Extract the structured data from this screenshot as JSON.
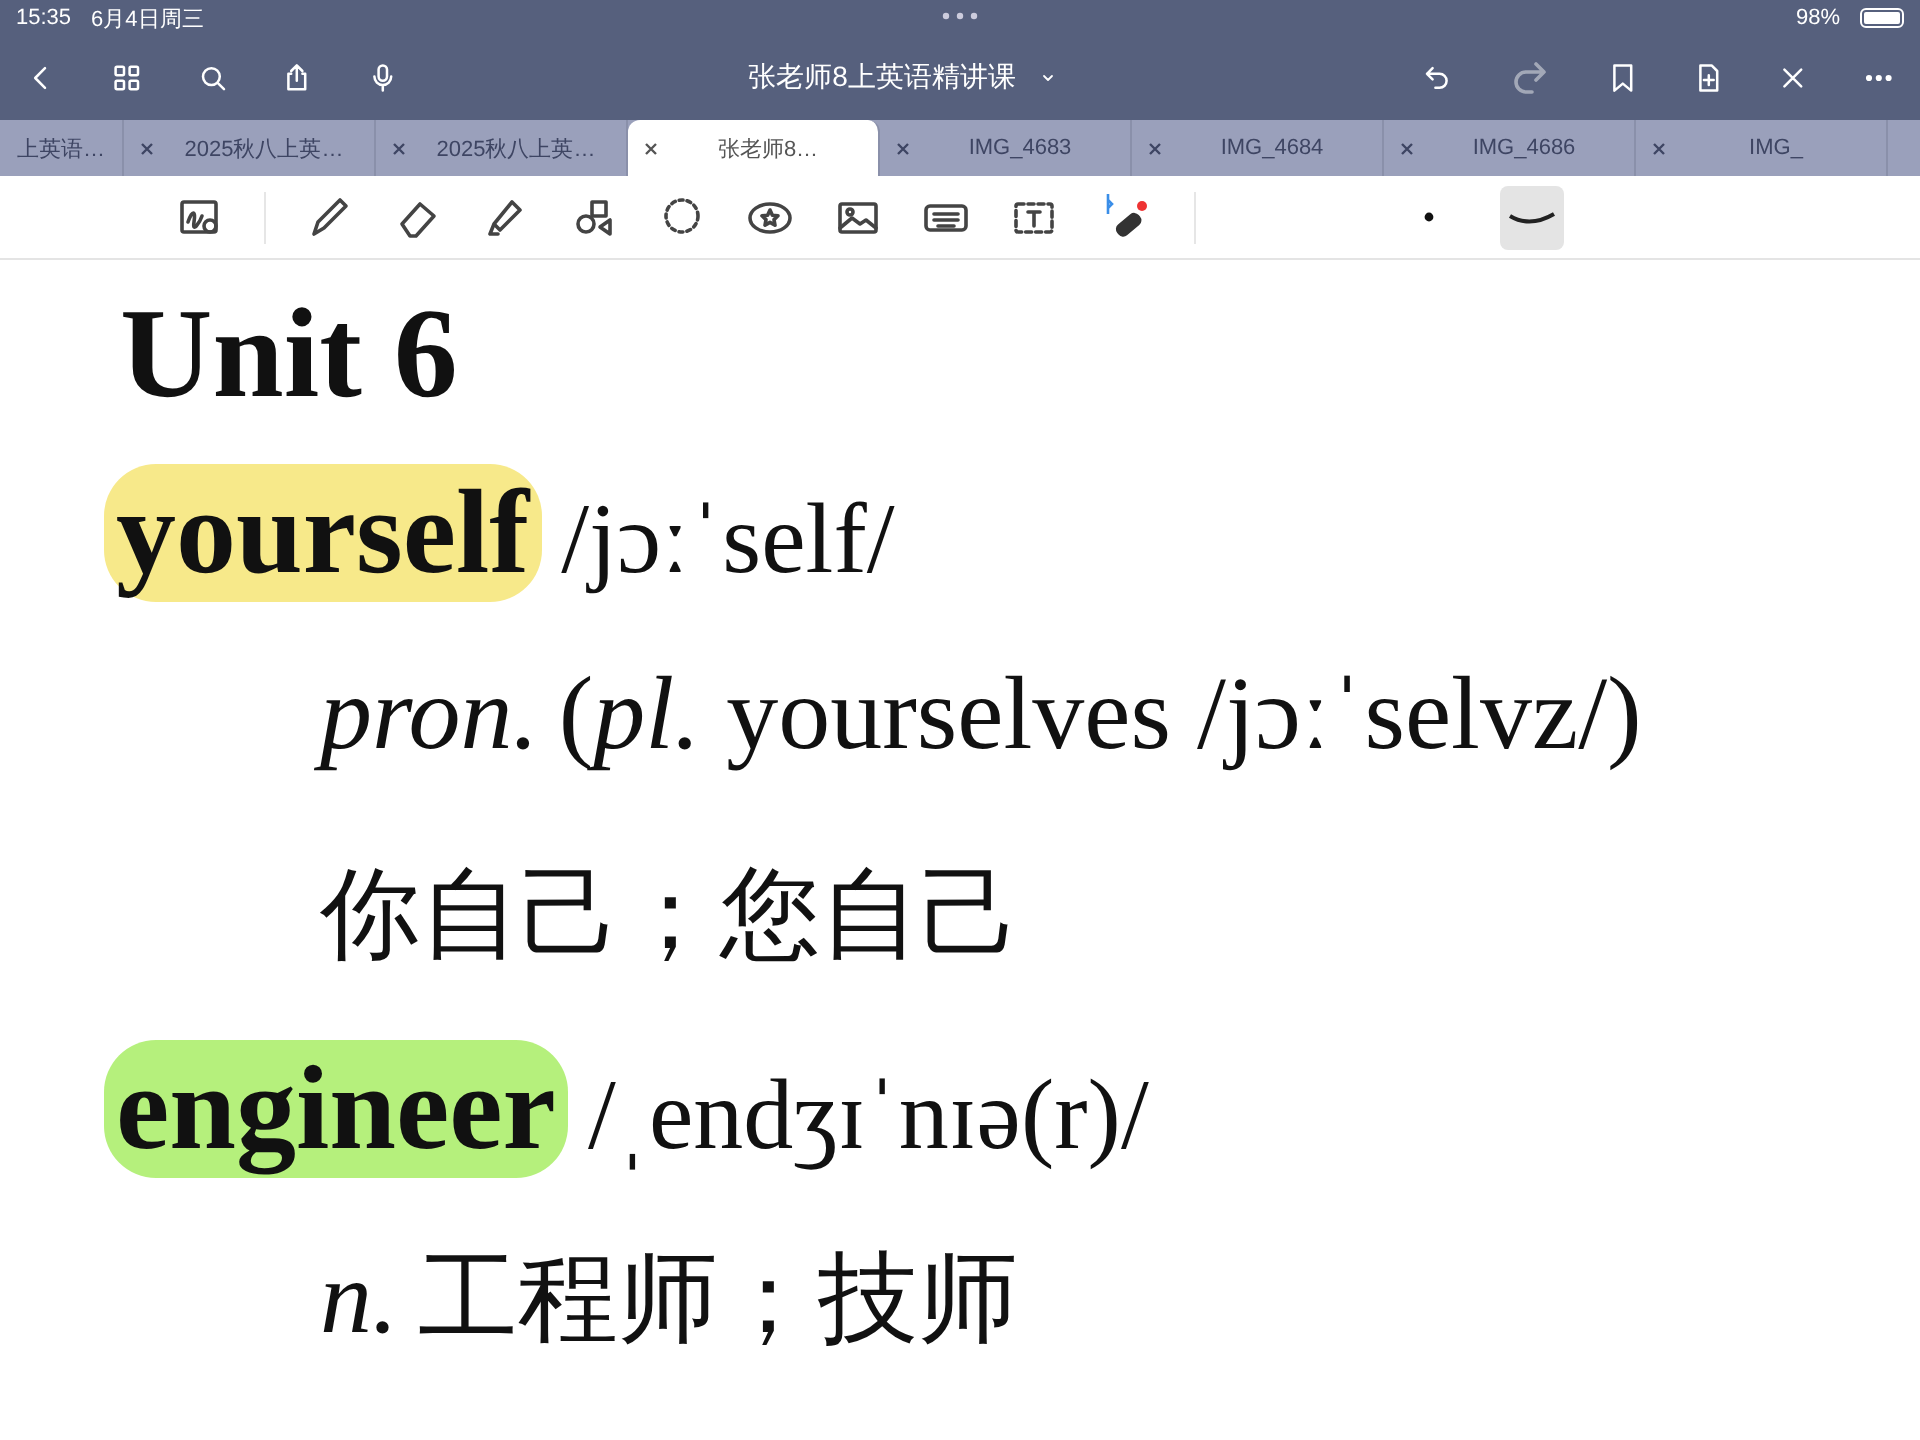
{
  "status_bar": {
    "time": "15:35",
    "date": "6月4日周三",
    "battery": "98%"
  },
  "nav": {
    "title": "张老师8上英语精讲课"
  },
  "tabs": [
    {
      "label": "上英语…",
      "selected": false
    },
    {
      "label": "2025秋八上英…",
      "selected": false
    },
    {
      "label": "2025秋八上英…",
      "selected": false
    },
    {
      "label": "张老师8…",
      "selected": true
    },
    {
      "label": "IMG_4683",
      "selected": false
    },
    {
      "label": "IMG_4684",
      "selected": false
    },
    {
      "label": "IMG_4686",
      "selected": false
    },
    {
      "label": "IMG_",
      "selected": false
    }
  ],
  "stroke_sizes": [
    {
      "kind": "dot",
      "selected": false
    },
    {
      "kind": "curve",
      "selected": true
    }
  ],
  "document": {
    "heading": "Unit 6",
    "entries": [
      {
        "word": "yourself",
        "color": "#f7e98a",
        "phonetic": "/jɔːˈself/",
        "lines": [
          {
            "kind": "pos",
            "pos": "pron.",
            "text": "(*pl.* yourselves /jɔːˈselvz/)"
          },
          {
            "kind": "meaning",
            "text": "你自己；您自己"
          }
        ]
      },
      {
        "word": "engineer",
        "color": "#b5f07c",
        "phonetic": "/ˌendʒɪˈnɪə(r)/",
        "lines": [
          {
            "kind": "pos",
            "pos": "n.",
            "text": "工程师；技师"
          }
        ]
      }
    ]
  }
}
